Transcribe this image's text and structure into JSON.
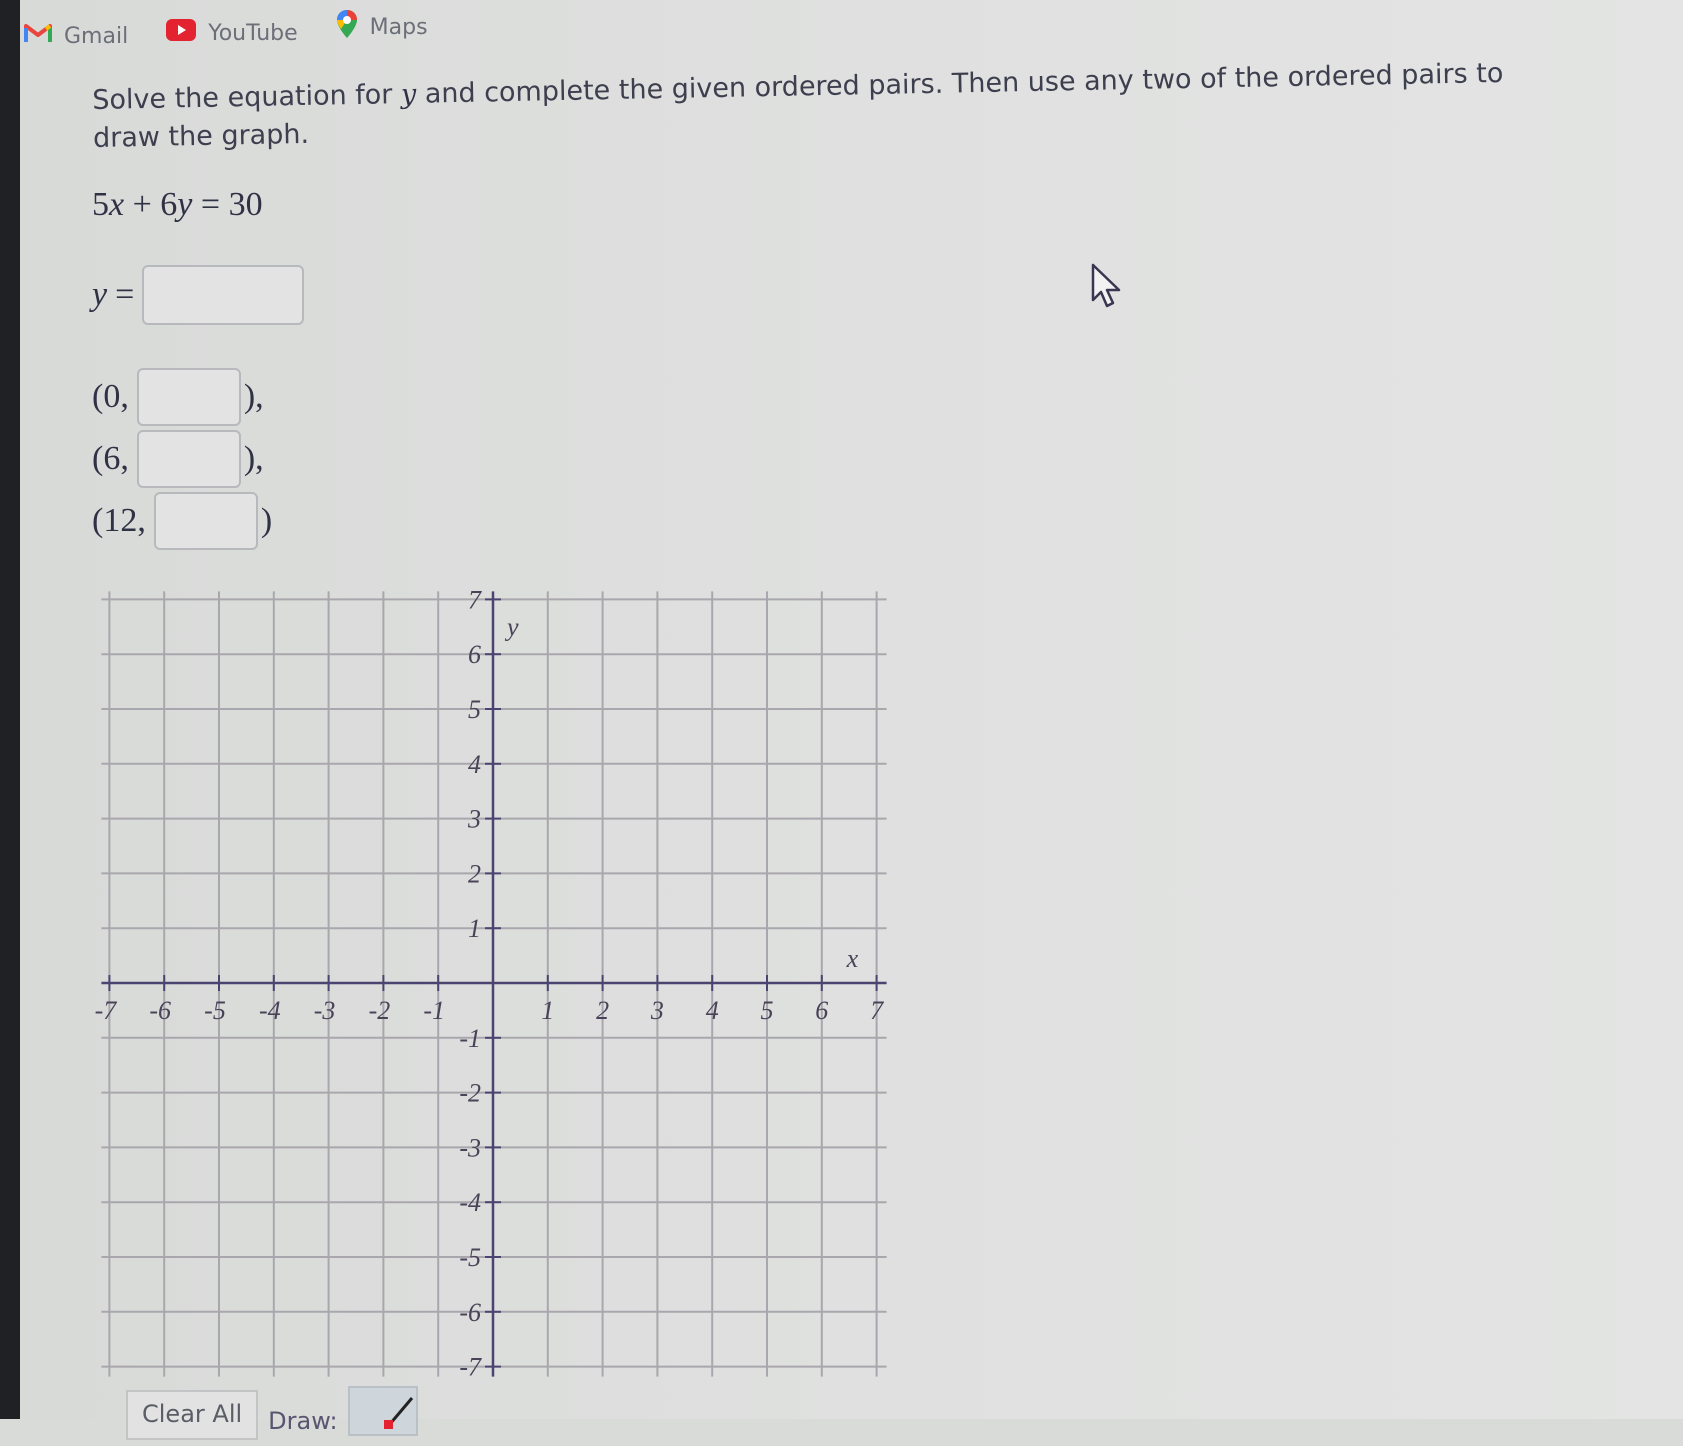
{
  "bookmarks": [
    {
      "label": "Gmail",
      "icon": "gmail-icon"
    },
    {
      "label": "YouTube",
      "icon": "youtube-icon"
    },
    {
      "label": "Maps",
      "icon": "maps-icon"
    }
  ],
  "question": {
    "text_before_var": "Solve the equation for ",
    "variable": "y",
    "text_after_var": " and complete the given ordered pairs. Then use any two of the ordered pairs to draw the graph."
  },
  "equation": {
    "lhs_coef_x": "5",
    "var_x": "x",
    "plus": "+",
    "lhs_coef_y": "6",
    "var_y": "y",
    "equals": "=",
    "rhs": "30"
  },
  "solve_for": {
    "label_var": "y",
    "label_eq": "=",
    "value": ""
  },
  "ordered_pairs": [
    {
      "open": "(0,",
      "y_value": "",
      "close": "),"
    },
    {
      "open": "(6,",
      "y_value": "",
      "close": "),"
    },
    {
      "open": "(12,",
      "y_value": "",
      "close": ")"
    }
  ],
  "chart_data": {
    "type": "scatter",
    "title": "",
    "xlabel": "x",
    "ylabel": "y",
    "xlim": [
      -7,
      7
    ],
    "ylim": [
      -7,
      7
    ],
    "grid": true,
    "x_ticks": [
      "-7",
      "-6",
      "-5",
      "-4",
      "-3",
      "-2",
      "-1",
      "1",
      "2",
      "3",
      "4",
      "5",
      "6",
      "7"
    ],
    "y_ticks": [
      "7",
      "6",
      "5",
      "4",
      "3",
      "2",
      "1",
      "-1",
      "-2",
      "-3",
      "-4",
      "-5",
      "-6",
      "-7"
    ],
    "series": []
  },
  "toolbar": {
    "clear_all_label": "Clear All",
    "draw_label": "Draw:",
    "draw_tool_icon": "line-tool-icon"
  },
  "colors": {
    "axis": "#4b4470",
    "grid": "#a9a7ad",
    "tick_label": "#4a4358",
    "youtube_red": "#e3232f"
  }
}
